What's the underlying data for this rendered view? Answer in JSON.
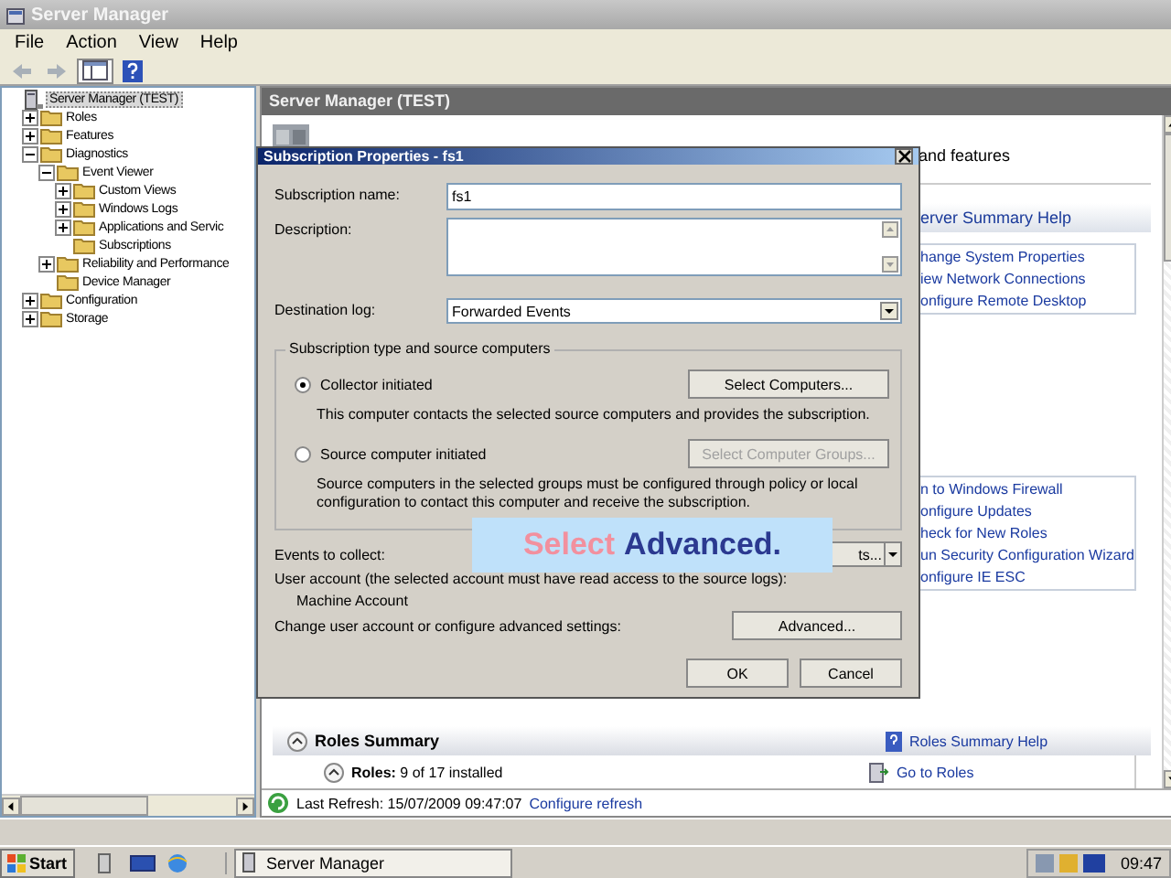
{
  "window": {
    "title": "Server Manager"
  },
  "menu": [
    "File",
    "Action",
    "View",
    "Help"
  ],
  "tree": [
    {
      "label": "Server Manager (TEST)",
      "selected": true,
      "children": [
        {
          "label": "Roles",
          "selected": false,
          "expanded": false
        },
        {
          "label": "Features",
          "selected": false,
          "expanded": false
        },
        {
          "label": "Diagnostics",
          "selected": false,
          "expanded": true,
          "children": [
            {
              "label": "Event Viewer",
              "selected": false,
              "expanded": true,
              "children": [
                {
                  "label": "Custom Views",
                  "selected": false,
                  "expanded": false
                },
                {
                  "label": "Windows Logs",
                  "selected": false,
                  "expanded": false
                },
                {
                  "label": "Applications and Servic",
                  "selected": false,
                  "expanded": false
                },
                {
                  "label": "Subscriptions",
                  "selected": false
                }
              ]
            },
            {
              "label": "Reliability and Performance",
              "selected": false,
              "expanded": false
            },
            {
              "label": "Device Manager",
              "selected": false
            }
          ]
        },
        {
          "label": "Configuration",
          "selected": false,
          "expanded": false
        },
        {
          "label": "Storage",
          "selected": false,
          "expanded": false
        }
      ]
    }
  ],
  "main": {
    "header": "Server Manager (TEST)",
    "intro_tail": "and features",
    "help_title": "erver Summary Help",
    "tasks_1": [
      "hange System Properties",
      "iew Network Connections",
      "onfigure Remote Desktop"
    ],
    "tasks_2": [
      "n to Windows Firewall",
      "onfigure Updates",
      "heck for New Roles",
      "un Security Configuration Wizard",
      "onfigure IE ESC"
    ],
    "roles_summary": {
      "title": "Roles Summary",
      "help": "Roles Summary Help",
      "count": "**Roles:** 9 of 17 installed",
      "go_to": "Go to Roles"
    }
  },
  "status": {
    "refresh": "Last Refresh: 15/07/2009 09:47:07",
    "configure": "Configure refresh"
  },
  "dialog": {
    "title": "Subscription Properties - fs1",
    "name_label": "Subscription name:",
    "name_value": "fs1",
    "description_label": "Description:",
    "log_label": "Destination log:",
    "log_value": "Forwarded Events",
    "group_title": "Subscription type and source computers",
    "options": [
      {
        "label": "Collector initiated",
        "selected": true,
        "button": "Select Computers...",
        "button_disabled": false,
        "note": "This computer contacts the selected source computers and provides the subscription."
      },
      {
        "label": "Source computer initiated",
        "selected": false,
        "button": "Select Computer Groups...",
        "button_disabled": true,
        "note": "Source computers in the selected groups must be configured through policy or local configuration to contact this computer and receive the subscription."
      }
    ],
    "events_label": "Events to collect:",
    "events_value": "ts...",
    "account_label": "User account (the selected account must have read access to the source logs):",
    "account_value": "Machine Account",
    "advanced_label": "Change user account or configure advanced settings:",
    "advanced_button": "Advanced...",
    "buttons": [
      "OK",
      "Cancel"
    ]
  },
  "caption": [
    {
      "text": "Select",
      "color": "#f2909e"
    },
    {
      "text": "Advanced.",
      "color": "#2b3990"
    }
  ],
  "taskbar": {
    "start": "Start",
    "task": "Server Manager",
    "clock": "09:47"
  }
}
